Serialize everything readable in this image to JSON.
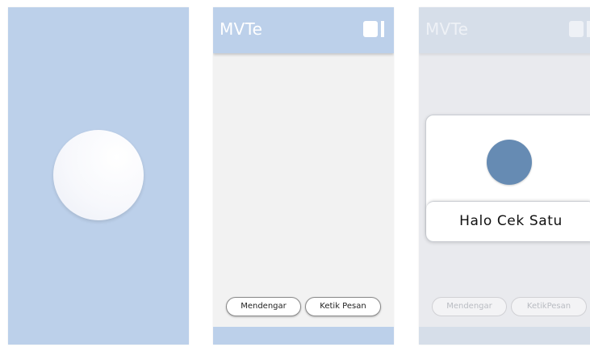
{
  "app": {
    "title": "MVTe",
    "menu_icon": "menu-toggle-icon"
  },
  "main": {
    "buttons": {
      "listen_label": "Mendengar",
      "type_message_label": "Ketik Pesan"
    }
  },
  "overlay": {
    "title": "MVTe",
    "caption": "Halo Cek Satu",
    "buttons": {
      "listen_label": "Mendengar",
      "type_message_label": "KetikPesan"
    }
  },
  "colors": {
    "primary": "#bcd0ea",
    "background": "#f2f2f2",
    "accent_dot": "#668bb3"
  }
}
